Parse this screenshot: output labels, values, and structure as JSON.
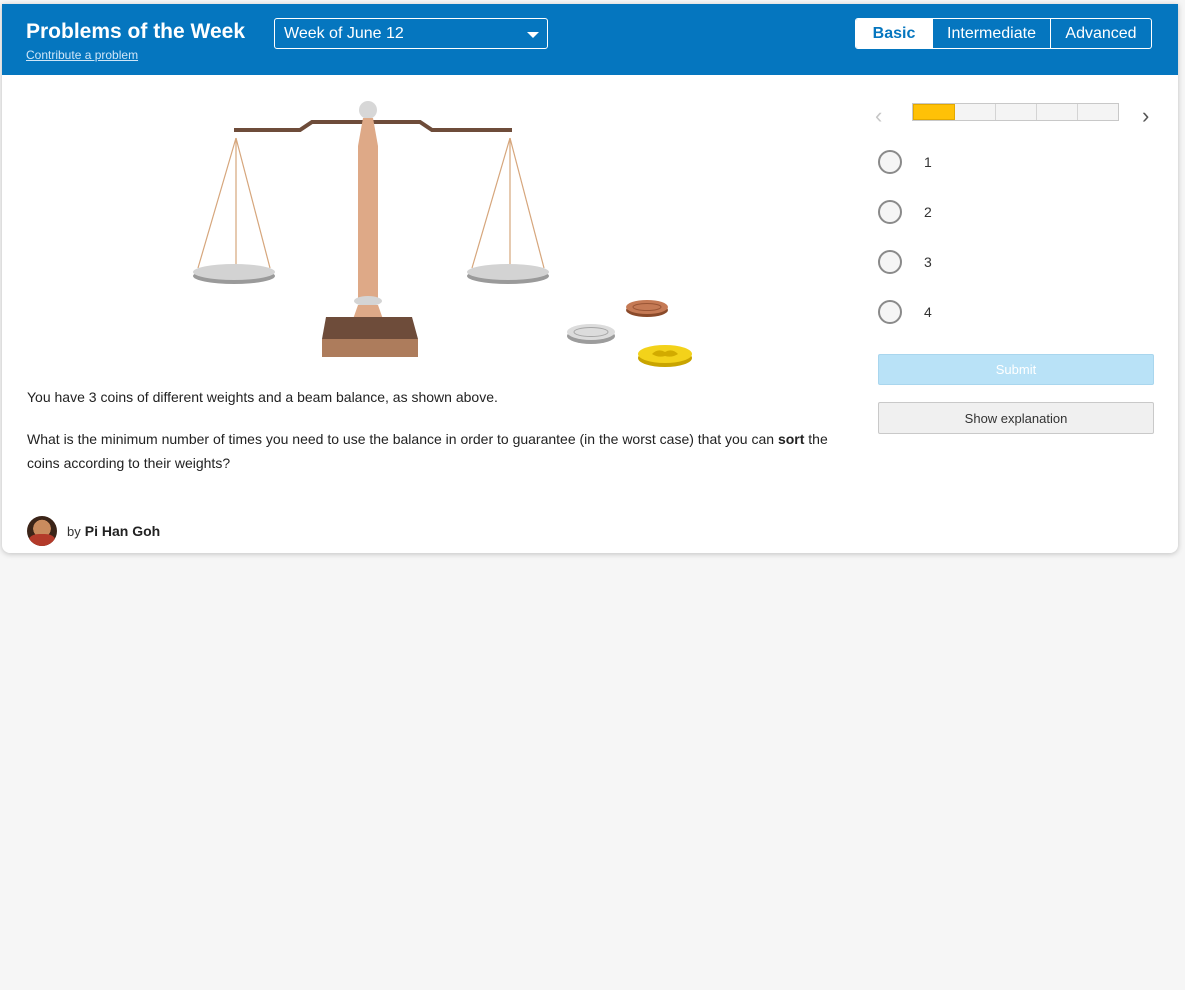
{
  "header": {
    "title": "Problems of the Week",
    "contribute_link": "Contribute a problem",
    "week_select": "Week of June 12",
    "levels": [
      "Basic",
      "Intermediate",
      "Advanced"
    ],
    "active_level": "Basic"
  },
  "problem": {
    "paragraph1": "You have 3 coins of different weights and a beam balance, as shown above.",
    "paragraph2_before": "What is the minimum number of times you need to use the balance in order to guarantee (in the worst case) that you can ",
    "paragraph2_bold": "sort",
    "paragraph2_after": " the coins according to their weights?"
  },
  "author": {
    "by": "by",
    "name": "Pi Han Goh"
  },
  "navigation": {
    "progress_done": 1,
    "progress_total": 5
  },
  "choices": [
    "1",
    "2",
    "3",
    "4"
  ],
  "buttons": {
    "submit": "Submit",
    "show_explanation": "Show explanation"
  },
  "colors": {
    "header_blue": "#0576bf",
    "progress_yellow": "#ffc107",
    "submit_disabled": "#b9e2f7"
  }
}
